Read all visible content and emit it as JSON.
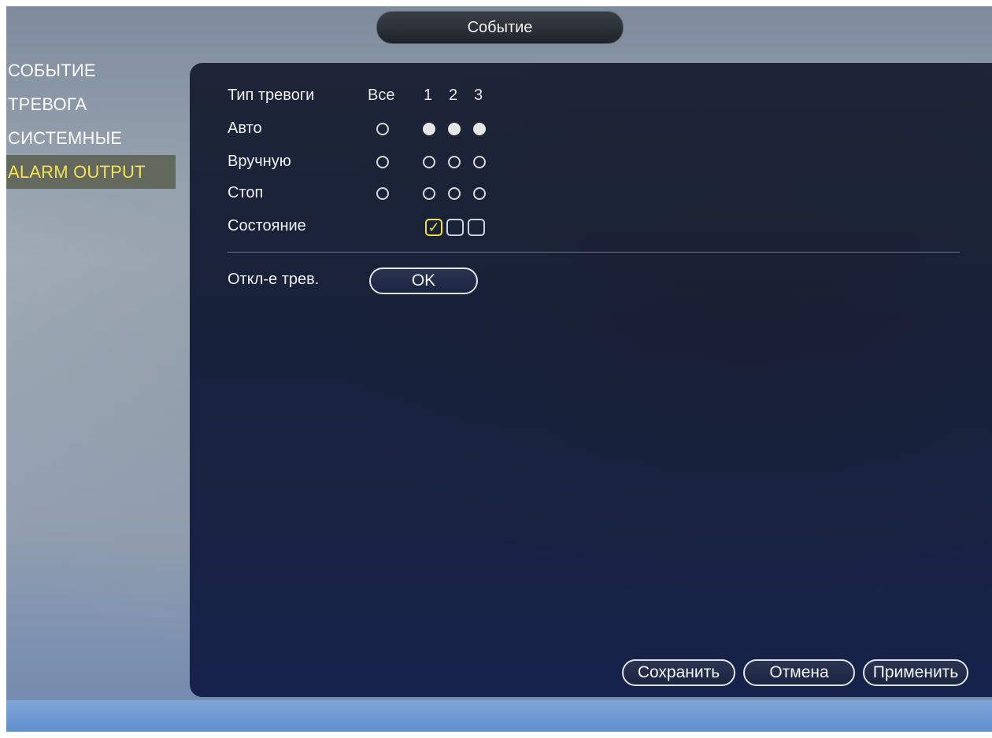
{
  "window": {
    "title": "Событие"
  },
  "sidebar": {
    "items": [
      {
        "label": "СОБЫТИЕ"
      },
      {
        "label": "ТРЕВОГА"
      },
      {
        "label": "СИСТЕМНЫЕ"
      },
      {
        "label": "ALARM OUTPUT",
        "active": true
      }
    ]
  },
  "alarm_table": {
    "type_label": "Тип тревоги",
    "all_label": "Все",
    "channels": [
      "1",
      "2",
      "3"
    ],
    "rows": [
      {
        "label": "Авто",
        "all": false,
        "channels": [
          true,
          true,
          true
        ]
      },
      {
        "label": "Вручную",
        "all": false,
        "channels": [
          false,
          false,
          false
        ]
      },
      {
        "label": "Стоп",
        "all": false,
        "channels": [
          false,
          false,
          false
        ]
      }
    ],
    "status_label": "Состояние",
    "status": [
      true,
      false,
      false
    ]
  },
  "alarm_off": {
    "label": "Откл-е трев.",
    "button_label": "OK"
  },
  "footer": {
    "save_label": "Сохранить",
    "cancel_label": "Отмена",
    "apply_label": "Применить"
  },
  "colors": {
    "accent": "#f6e05a",
    "panel": "#1b2440"
  },
  "icons": {
    "checked": "checkmark-icon"
  }
}
